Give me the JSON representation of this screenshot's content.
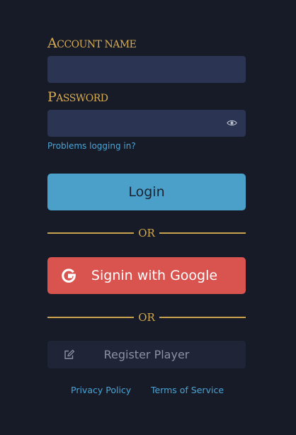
{
  "form": {
    "account_name_label_first": "A",
    "account_name_label_rest": "CCOUNT NAME",
    "account_name_value": "",
    "password_label_first": "P",
    "password_label_rest": "ASSWORD",
    "password_value": "",
    "problems_link": "Problems logging in?",
    "login_button": "Login",
    "or_separator": "OR",
    "google_button": "Signin with Google",
    "register_button": "Register Player"
  },
  "footer": {
    "privacy_link": "Privacy Policy",
    "terms_link": "Terms of Service"
  },
  "icons": {
    "password_toggle": "eye-icon",
    "google": "google-g-icon",
    "register": "edit-icon"
  },
  "colors": {
    "background": "#161b27",
    "label_gold": "#d8ac52",
    "input_bg": "#2c3454",
    "link_blue": "#4aa4d6",
    "login_button": "#4aa0c8",
    "google_button": "#d9534f",
    "register_button": "#1f2536"
  }
}
